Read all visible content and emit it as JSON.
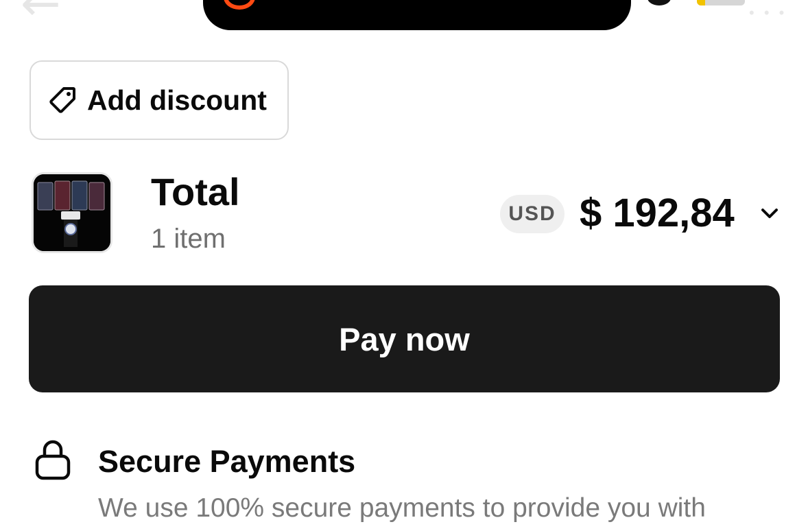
{
  "discount": {
    "label": "Add discount",
    "icon": "tag-icon"
  },
  "total": {
    "title": "Total",
    "items_count": "1 item",
    "currency": "USD",
    "amount": "$ 192,84",
    "expand_icon": "chevron-down-icon"
  },
  "pay_button": {
    "label": "Pay now"
  },
  "secure": {
    "icon": "lock-icon",
    "title": "Secure Payments",
    "description": "We use 100% secure payments to provide you with"
  },
  "colors": {
    "primary_button": "#1a1a1a",
    "muted_text": "#6f6f6f",
    "badge_bg": "#efefef",
    "island_accent": "#ff4a12",
    "battery_level": "#f2c300"
  }
}
